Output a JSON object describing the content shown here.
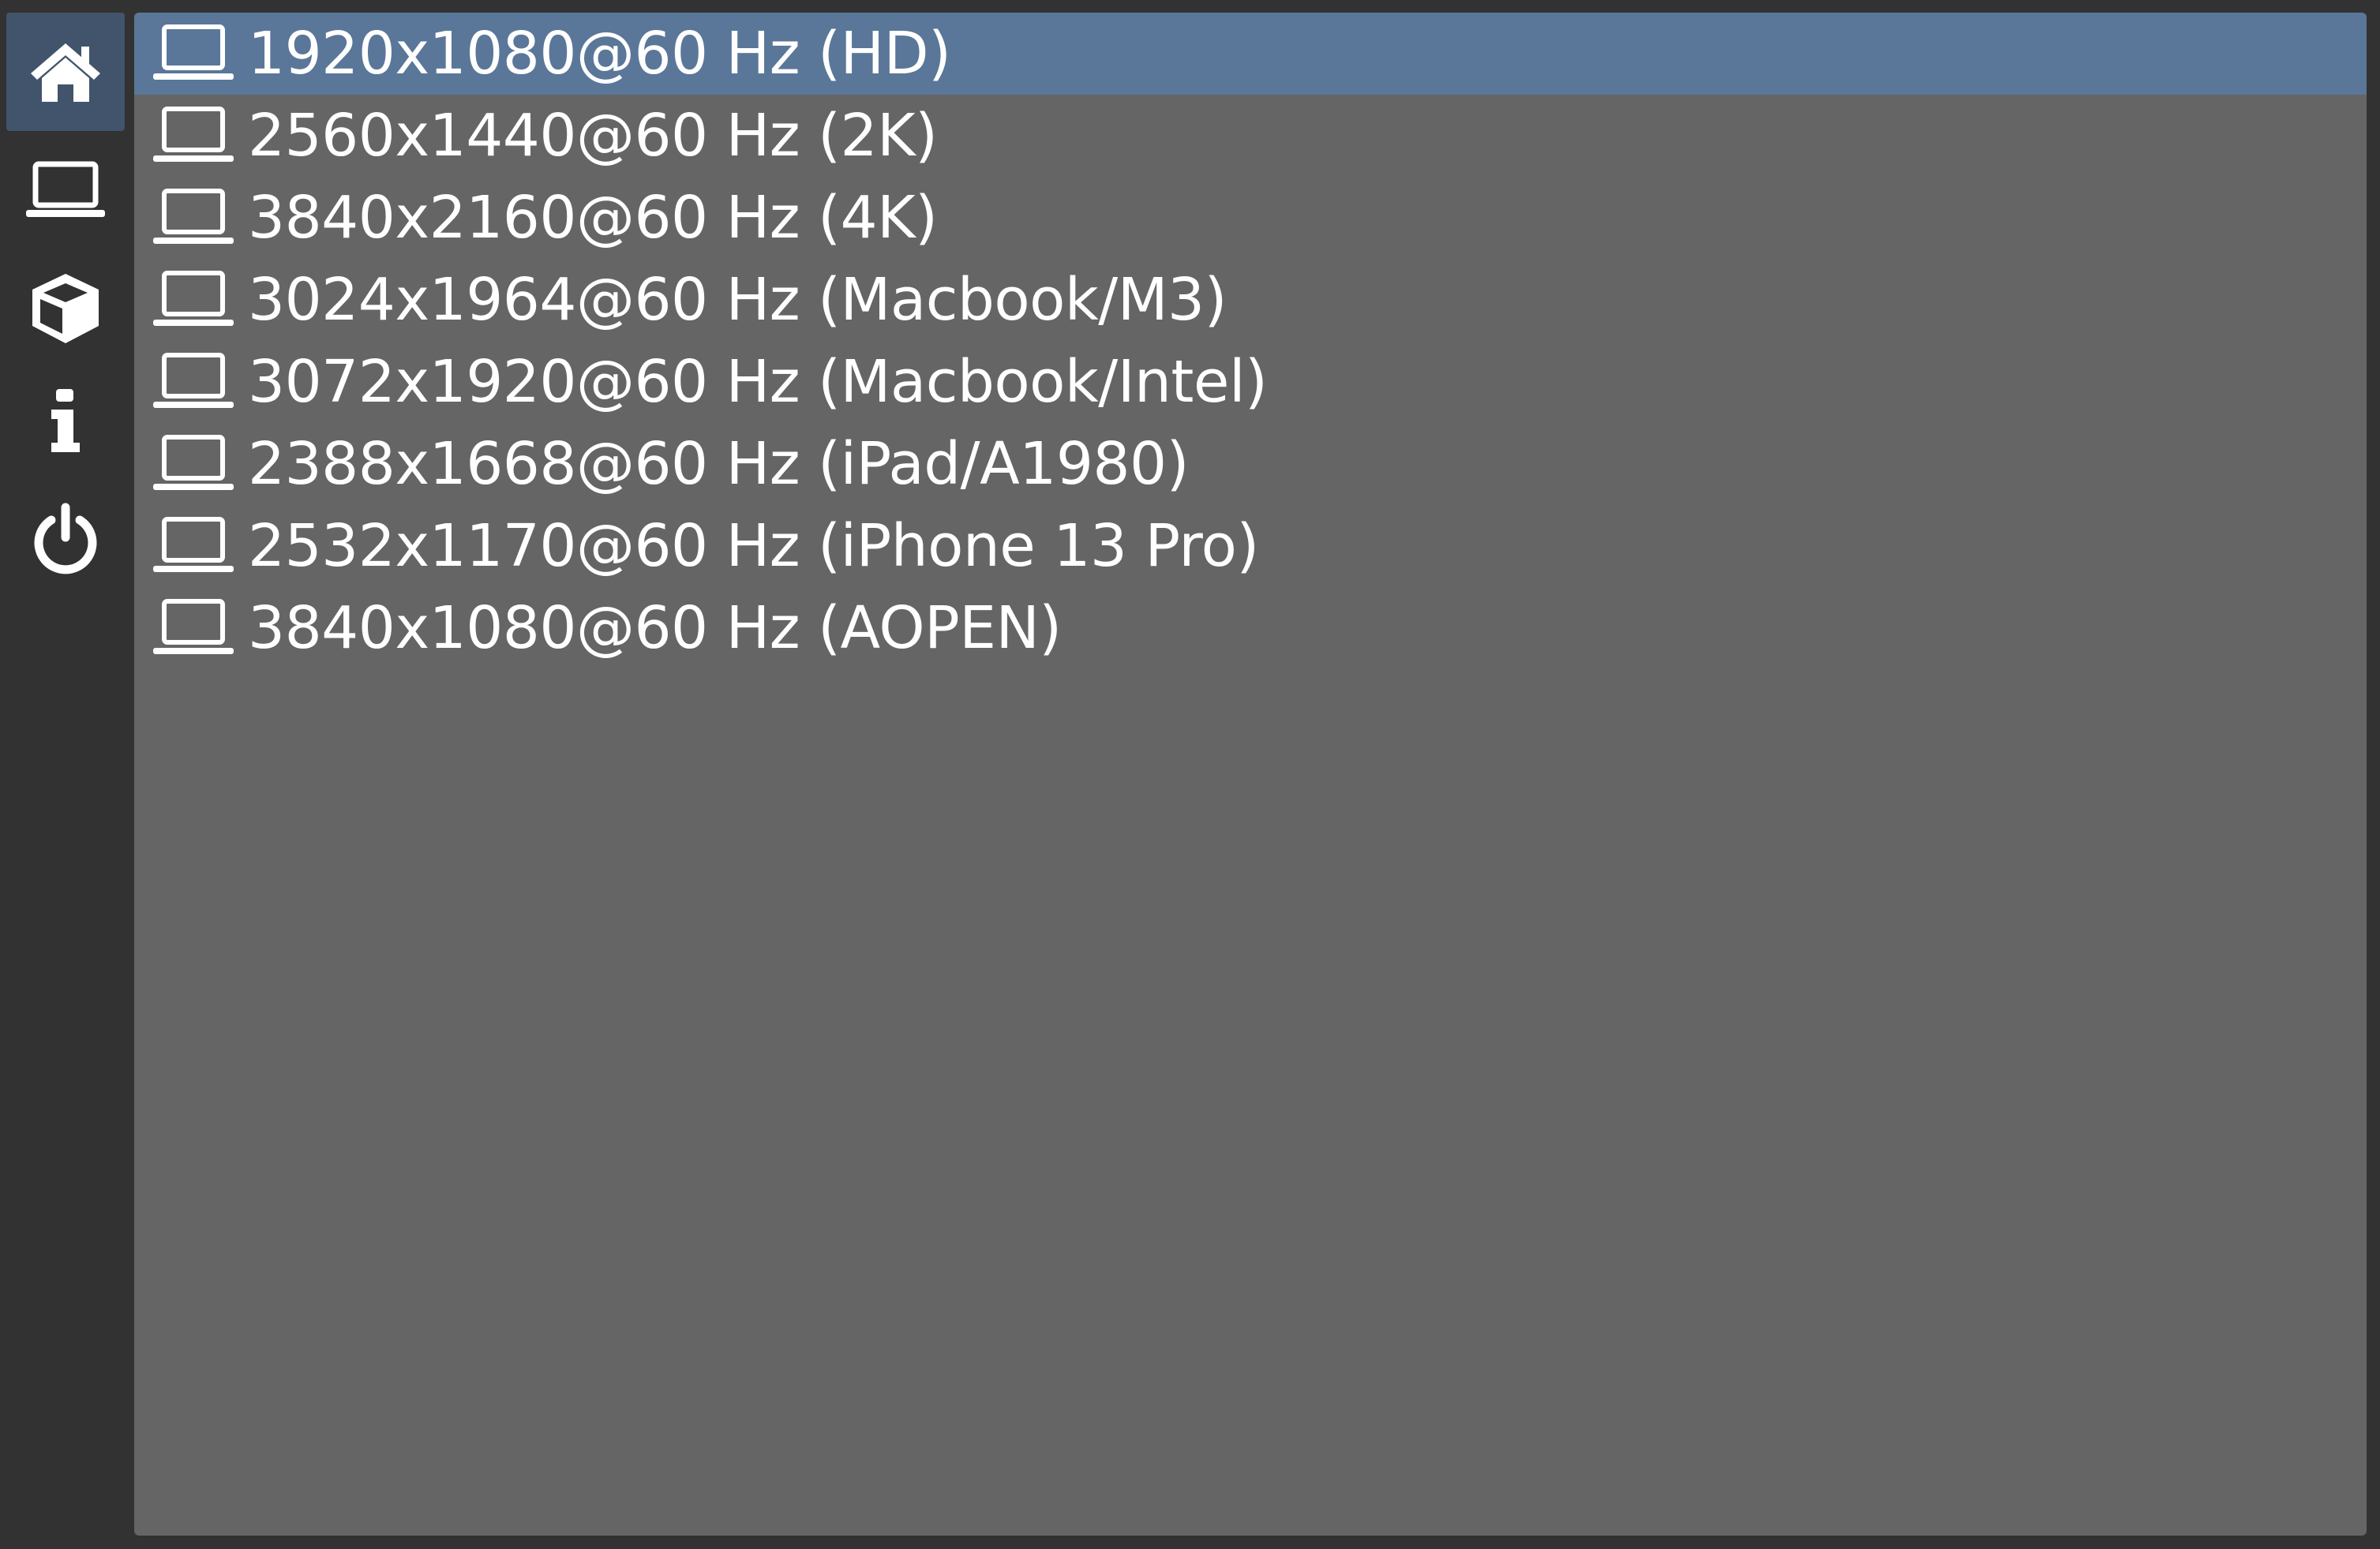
{
  "sidebar": {
    "items": [
      {
        "name": "home",
        "icon": "home-icon",
        "active": true
      },
      {
        "name": "display",
        "icon": "laptop-icon",
        "active": false
      },
      {
        "name": "packages",
        "icon": "cube-icon",
        "active": false
      },
      {
        "name": "info",
        "icon": "info-icon",
        "active": false
      },
      {
        "name": "power",
        "icon": "power-icon",
        "active": false
      }
    ]
  },
  "resolutions": {
    "selected_index": 0,
    "items": [
      {
        "label": "1920x1080@60 Hz (HD)",
        "icon": "laptop-icon"
      },
      {
        "label": "2560x1440@60 Hz (2K)",
        "icon": "laptop-icon"
      },
      {
        "label": "3840x2160@60 Hz (4K)",
        "icon": "laptop-icon"
      },
      {
        "label": "3024x1964@60 Hz (Macbook/M3)",
        "icon": "laptop-icon"
      },
      {
        "label": "3072x1920@60 Hz (Macbook/Intel)",
        "icon": "laptop-icon"
      },
      {
        "label": "2388x1668@60 Hz (iPad/A1980)",
        "icon": "laptop-icon"
      },
      {
        "label": "2532x1170@60 Hz (iPhone 13 Pro)",
        "icon": "laptop-icon"
      },
      {
        "label": "3840x1080@60 Hz (AOPEN)",
        "icon": "laptop-icon"
      }
    ]
  },
  "colors": {
    "background": "#323232",
    "panel": "#656565",
    "selected_row": "#5a7799",
    "active_sidebar": "#41546b",
    "text": "#ffffff"
  }
}
